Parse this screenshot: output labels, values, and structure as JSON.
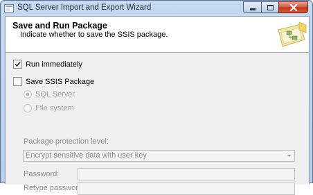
{
  "window": {
    "title": "SQL Server Import and Export Wizard"
  },
  "header": {
    "title": "Save and Run Package",
    "subtitle": "Indicate whether to save the SSIS package."
  },
  "options": {
    "run_immediately": {
      "label": "Run immediately",
      "checked": true
    },
    "save_ssis_package": {
      "label": "Save SSIS Package",
      "checked": false
    },
    "location": {
      "sql_server": {
        "label": "SQL Server",
        "selected": true,
        "enabled": false
      },
      "file_system": {
        "label": "File system",
        "selected": false,
        "enabled": false
      }
    }
  },
  "protection": {
    "label": "Package protection level:",
    "selected": "Encrypt sensitive data with user key"
  },
  "password": {
    "label": "Password:",
    "value": ""
  },
  "retype_password": {
    "label": "Retype password:",
    "value": ""
  }
}
